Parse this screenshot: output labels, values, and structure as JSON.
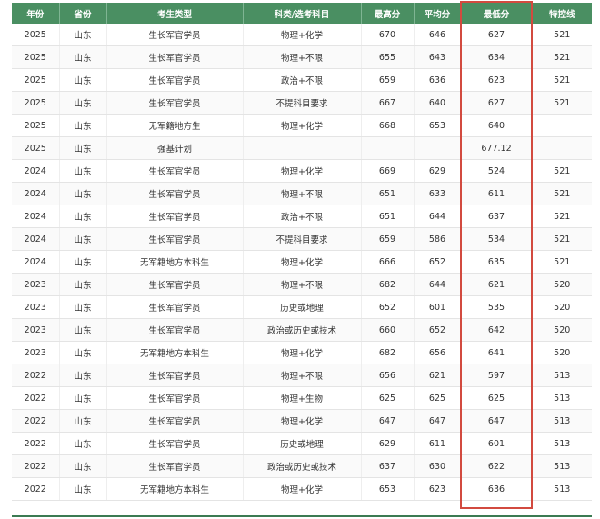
{
  "columns": [
    "年份",
    "省份",
    "考生类型",
    "科类/选考科目",
    "最高分",
    "平均分",
    "最低分",
    "特控线"
  ],
  "rows": [
    [
      "2025",
      "山东",
      "生长军官学员",
      "物理+化学",
      "670",
      "646",
      "627",
      "521"
    ],
    [
      "2025",
      "山东",
      "生长军官学员",
      "物理+不限",
      "655",
      "643",
      "634",
      "521"
    ],
    [
      "2025",
      "山东",
      "生长军官学员",
      "政治+不限",
      "659",
      "636",
      "623",
      "521"
    ],
    [
      "2025",
      "山东",
      "生长军官学员",
      "不提科目要求",
      "667",
      "640",
      "627",
      "521"
    ],
    [
      "2025",
      "山东",
      "无军籍地方生",
      "物理+化学",
      "668",
      "653",
      "640",
      ""
    ],
    [
      "2025",
      "山东",
      "强基计划",
      "",
      "",
      "",
      "677.12",
      ""
    ],
    [
      "2024",
      "山东",
      "生长军官学员",
      "物理+化学",
      "669",
      "629",
      "524",
      "521"
    ],
    [
      "2024",
      "山东",
      "生长军官学员",
      "物理+不限",
      "651",
      "633",
      "611",
      "521"
    ],
    [
      "2024",
      "山东",
      "生长军官学员",
      "政治+不限",
      "651",
      "644",
      "637",
      "521"
    ],
    [
      "2024",
      "山东",
      "生长军官学员",
      "不提科目要求",
      "659",
      "586",
      "534",
      "521"
    ],
    [
      "2024",
      "山东",
      "无军籍地方本科生",
      "物理+化学",
      "666",
      "652",
      "635",
      "521"
    ],
    [
      "2023",
      "山东",
      "生长军官学员",
      "物理+不限",
      "682",
      "644",
      "621",
      "520"
    ],
    [
      "2023",
      "山东",
      "生长军官学员",
      "历史或地理",
      "652",
      "601",
      "535",
      "520"
    ],
    [
      "2023",
      "山东",
      "生长军官学员",
      "政治或历史或技术",
      "660",
      "652",
      "642",
      "520"
    ],
    [
      "2023",
      "山东",
      "无军籍地方本科生",
      "物理+化学",
      "682",
      "656",
      "641",
      "520"
    ],
    [
      "2022",
      "山东",
      "生长军官学员",
      "物理+不限",
      "656",
      "621",
      "597",
      "513"
    ],
    [
      "2022",
      "山东",
      "生长军官学员",
      "物理+生物",
      "625",
      "625",
      "625",
      "513"
    ],
    [
      "2022",
      "山东",
      "生长军官学员",
      "物理+化学",
      "647",
      "647",
      "647",
      "513"
    ],
    [
      "2022",
      "山东",
      "生长军官学员",
      "历史或地理",
      "629",
      "611",
      "601",
      "513"
    ],
    [
      "2022",
      "山东",
      "生长军官学员",
      "政治或历史或技术",
      "637",
      "630",
      "622",
      "513"
    ],
    [
      "2022",
      "山东",
      "无军籍地方本科生",
      "物理+化学",
      "653",
      "623",
      "636",
      "513"
    ]
  ],
  "colors": {
    "header_bg": "#4a8f62",
    "highlight_border": "#d24a3f"
  }
}
